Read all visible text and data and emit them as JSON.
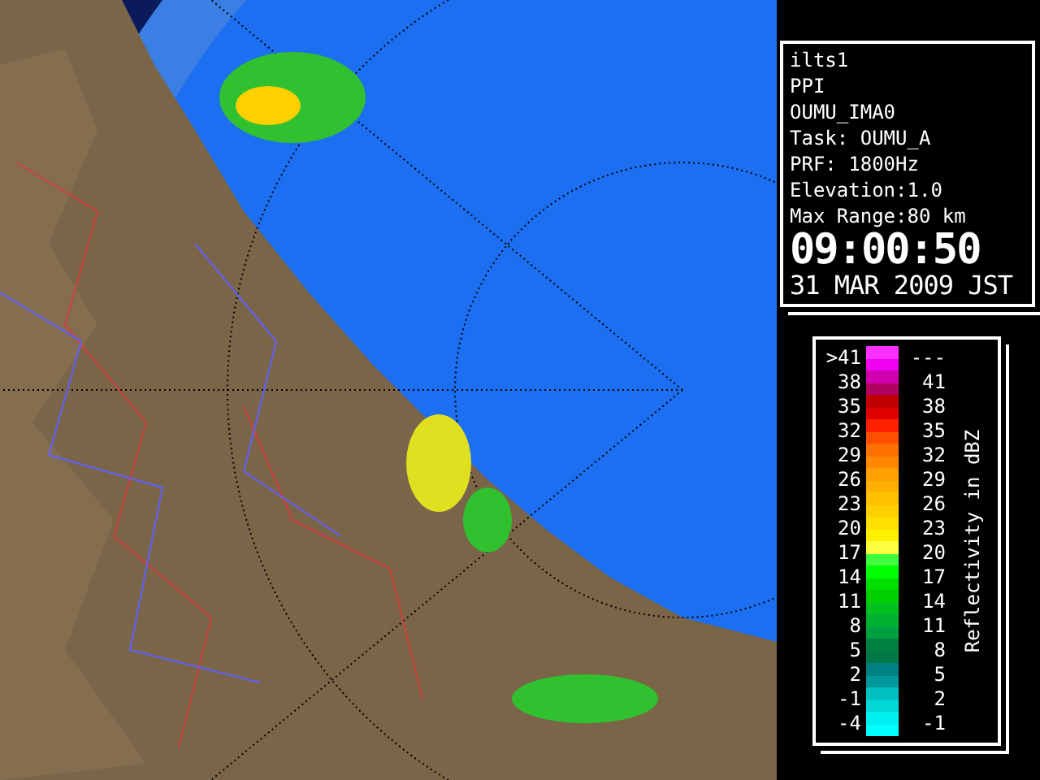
{
  "info": {
    "lines": [
      "ilts1",
      "PPI",
      "OUMU_IMA0",
      "Task: OUMU_A",
      "PRF: 1800Hz",
      "Elevation:1.0",
      "Max Range:80 km"
    ],
    "time": "09:00:50",
    "date": "31 MAR 2009 JST"
  },
  "legend": {
    "title": "Reflectivity in dBZ",
    "rows": [
      {
        "low": ">41",
        "high": "---"
      },
      {
        "low": "38",
        "high": "41"
      },
      {
        "low": "35",
        "high": "38"
      },
      {
        "low": "32",
        "high": "35"
      },
      {
        "low": "29",
        "high": "32"
      },
      {
        "low": "26",
        "high": "29"
      },
      {
        "low": "23",
        "high": "26"
      },
      {
        "low": "20",
        "high": "23"
      },
      {
        "low": "17",
        "high": "20"
      },
      {
        "low": "14",
        "high": "17"
      },
      {
        "low": "11",
        "high": "14"
      },
      {
        "low": "8",
        "high": "11"
      },
      {
        "low": "5",
        "high": "8"
      },
      {
        "low": "2",
        "high": "5"
      },
      {
        "low": "-1",
        "high": "2"
      },
      {
        "low": "-4",
        "high": "-1"
      }
    ],
    "swatches": [
      {
        "color": "#ff30ff"
      },
      {
        "color": "#f000f0"
      },
      {
        "color": "#d000b0"
      },
      {
        "color": "#b00060"
      },
      {
        "color": "#c00000"
      },
      {
        "color": "#e00000"
      },
      {
        "color": "#ff2000"
      },
      {
        "color": "#ff5000"
      },
      {
        "color": "#ff7000"
      },
      {
        "color": "#ff8800"
      },
      {
        "color": "#ffa000"
      },
      {
        "color": "#ffb000"
      },
      {
        "color": "#ffc000"
      },
      {
        "color": "#ffd000"
      },
      {
        "color": "#ffe000"
      },
      {
        "color": "#fff000"
      },
      {
        "color": "#ffff40"
      },
      {
        "color": "#40ff40"
      },
      {
        "color": "#00ff00"
      },
      {
        "color": "#00e000"
      },
      {
        "color": "#00d000"
      },
      {
        "color": "#00c020"
      },
      {
        "color": "#00b030"
      },
      {
        "color": "#00a040"
      },
      {
        "color": "#008040"
      },
      {
        "color": "#007848"
      },
      {
        "color": "#008080"
      },
      {
        "color": "#009898"
      },
      {
        "color": "#00c0c0"
      },
      {
        "color": "#00d8d8"
      },
      {
        "color": "#00f0f0"
      },
      {
        "color": "#00ffff"
      }
    ]
  }
}
